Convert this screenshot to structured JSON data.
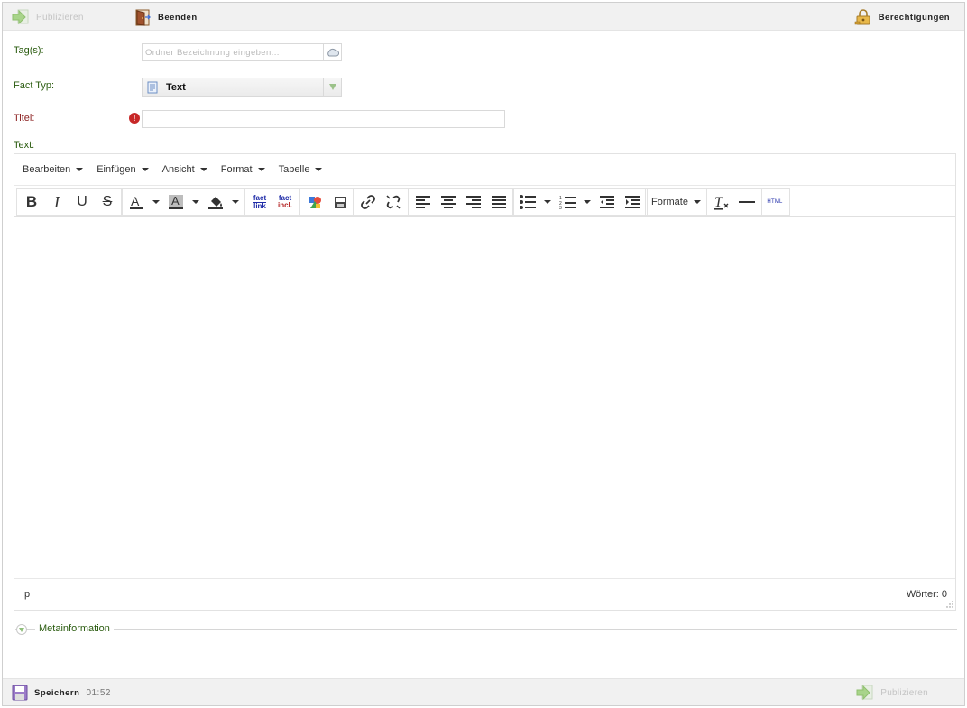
{
  "toolbar": {
    "publish_label": "Publizieren",
    "exit_label": "Beenden",
    "permissions_label": "Berechtigungen"
  },
  "form": {
    "tags_label": "Tag(s):",
    "tags_placeholder": "Ordner Bezeichnung eingeben...",
    "fact_type_label": "Fact Typ:",
    "fact_type_value": "Text",
    "title_label": "Titel:",
    "title_value": "",
    "text_label": "Text:"
  },
  "editor": {
    "menus": [
      "Bearbeiten",
      "Einfügen",
      "Ansicht",
      "Format",
      "Tabelle"
    ],
    "formats_label": "Formate",
    "fact_link_label_1": "fact",
    "fact_link_label_2": "link",
    "fact_incl_label_1": "fact",
    "fact_incl_label_2": "incl.",
    "html_label": "HTML",
    "status_path": "p",
    "word_count": "Wörter: 0"
  },
  "meta": {
    "label": "Metainformation"
  },
  "footer": {
    "save_label": "Speichern",
    "save_time": "01:52",
    "publish_label": "Publizieren"
  },
  "colors": {
    "label_green": "#2a5b0f",
    "required_red": "#8a1d1d",
    "toolbar_bg": "#f1f1f1"
  }
}
